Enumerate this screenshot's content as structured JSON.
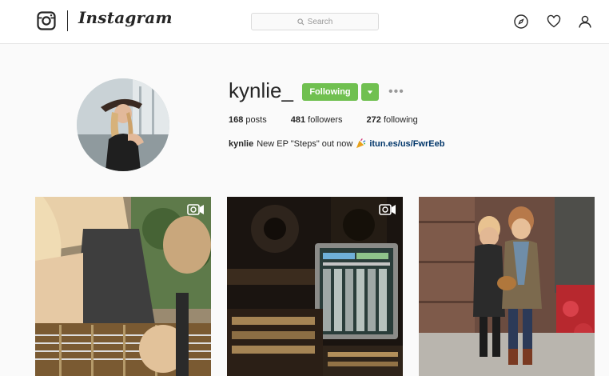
{
  "header": {
    "brand": "Instagram",
    "search_placeholder": "Search",
    "icons": [
      "camera-logo-icon",
      "compass-icon",
      "heart-icon",
      "person-icon"
    ]
  },
  "profile": {
    "username": "kynlie_",
    "following_label": "Following",
    "more_label": "•••",
    "posts_count": "168",
    "posts_label": "posts",
    "followers_count": "481",
    "followers_label": "followers",
    "following_count": "272",
    "following_stat_label": "following",
    "bio_name": "kynlie",
    "bio_text": "New EP \"Steps\" out now",
    "bio_link": "itun.es/us/FwrEeb"
  },
  "posts": [
    {
      "type": "video",
      "subject": "guitar player"
    },
    {
      "type": "video",
      "subject": "recording studio"
    },
    {
      "type": "photo",
      "subject": "two friends"
    }
  ],
  "colors": {
    "accent_green": "#70c050",
    "link": "#003569",
    "text": "#262626",
    "muted": "#999999"
  }
}
